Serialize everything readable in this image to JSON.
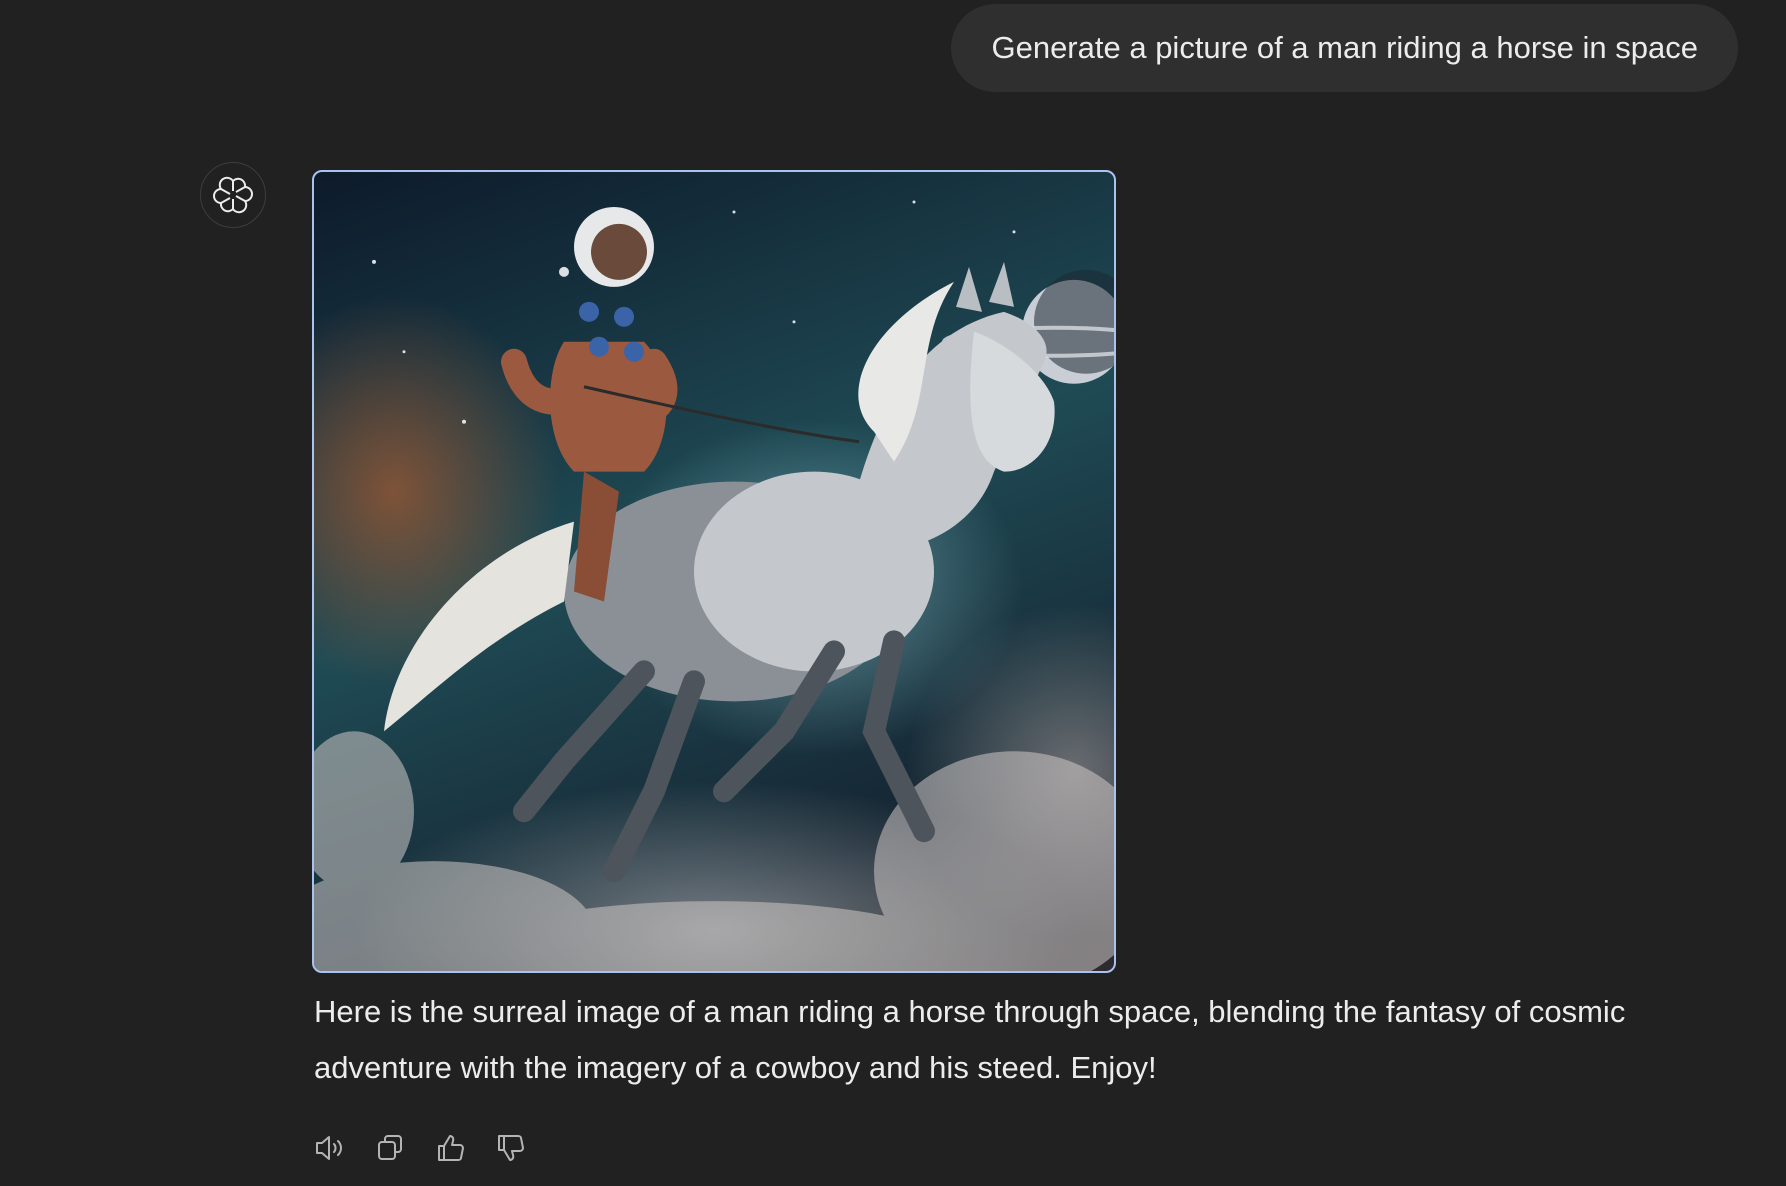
{
  "conversation": {
    "user_message": "Generate a picture of a man riding a horse in space",
    "assistant": {
      "avatar_icon": "openai-logo-icon",
      "image": {
        "subject_icon": "generated-image"
      },
      "response_text": "Here is the surreal image of a man riding a horse through space, blending the fantasy of cosmic adventure with the imagery of a cowboy and his steed. Enjoy!"
    },
    "actions": [
      {
        "icon": "speaker-icon"
      },
      {
        "icon": "copy-icon"
      },
      {
        "icon": "thumbs-up-icon"
      },
      {
        "icon": "thumbs-down-icon"
      }
    ]
  },
  "colors": {
    "background": "#212121",
    "user_bubble": "#2f2f2f",
    "text": "#ececec",
    "icon": "#b4b4b4",
    "image_border": "#a9c3f0"
  }
}
